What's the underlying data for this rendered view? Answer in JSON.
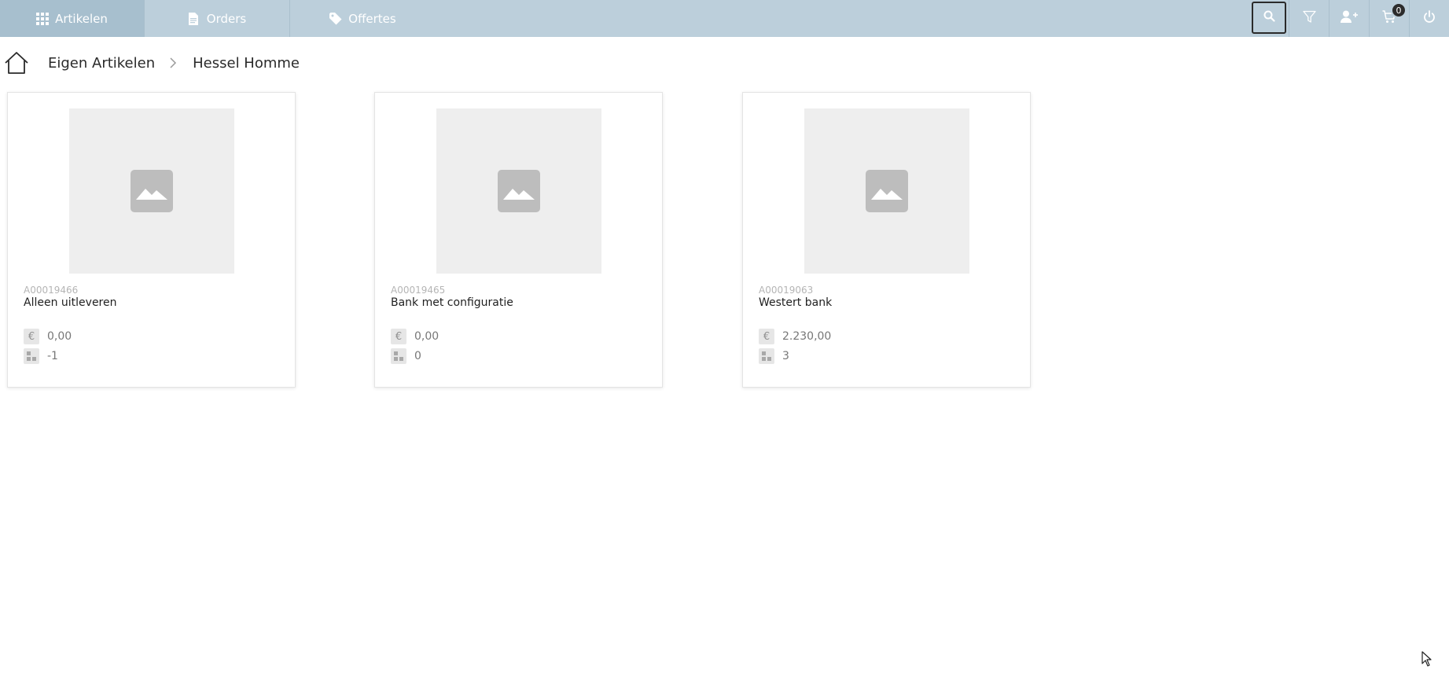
{
  "nav": {
    "tabs": [
      {
        "label": "Artikelen",
        "icon": "grid-icon",
        "active": true
      },
      {
        "label": "Orders",
        "icon": "document-icon",
        "active": false
      },
      {
        "label": "Offertes",
        "icon": "tag-icon",
        "active": false
      }
    ],
    "actions": {
      "search_icon": "search-icon",
      "filter_icon": "filter-icon",
      "add_user_icon": "add-user-icon",
      "cart_icon": "cart-icon",
      "cart_count": "0",
      "power_icon": "power-icon"
    }
  },
  "breadcrumb": {
    "home_icon": "home-icon",
    "items": [
      "Eigen Artikelen",
      "Hessel Homme"
    ]
  },
  "products": [
    {
      "code": "A00019466",
      "name": "Alleen uitleveren",
      "price": "0,00",
      "stock": "-1"
    },
    {
      "code": "A00019465",
      "name": "Bank met configuratie",
      "price": "0,00",
      "stock": "0"
    },
    {
      "code": "A00019063",
      "name": "Westert bank",
      "price": "2.230,00",
      "stock": "3"
    }
  ],
  "symbols": {
    "currency": "€"
  },
  "colors": {
    "topbar": "#bccfdb",
    "topbar_active": "#a7bfce",
    "placeholder_bg": "#eeeeee",
    "placeholder_icon": "#bdbdbd"
  }
}
